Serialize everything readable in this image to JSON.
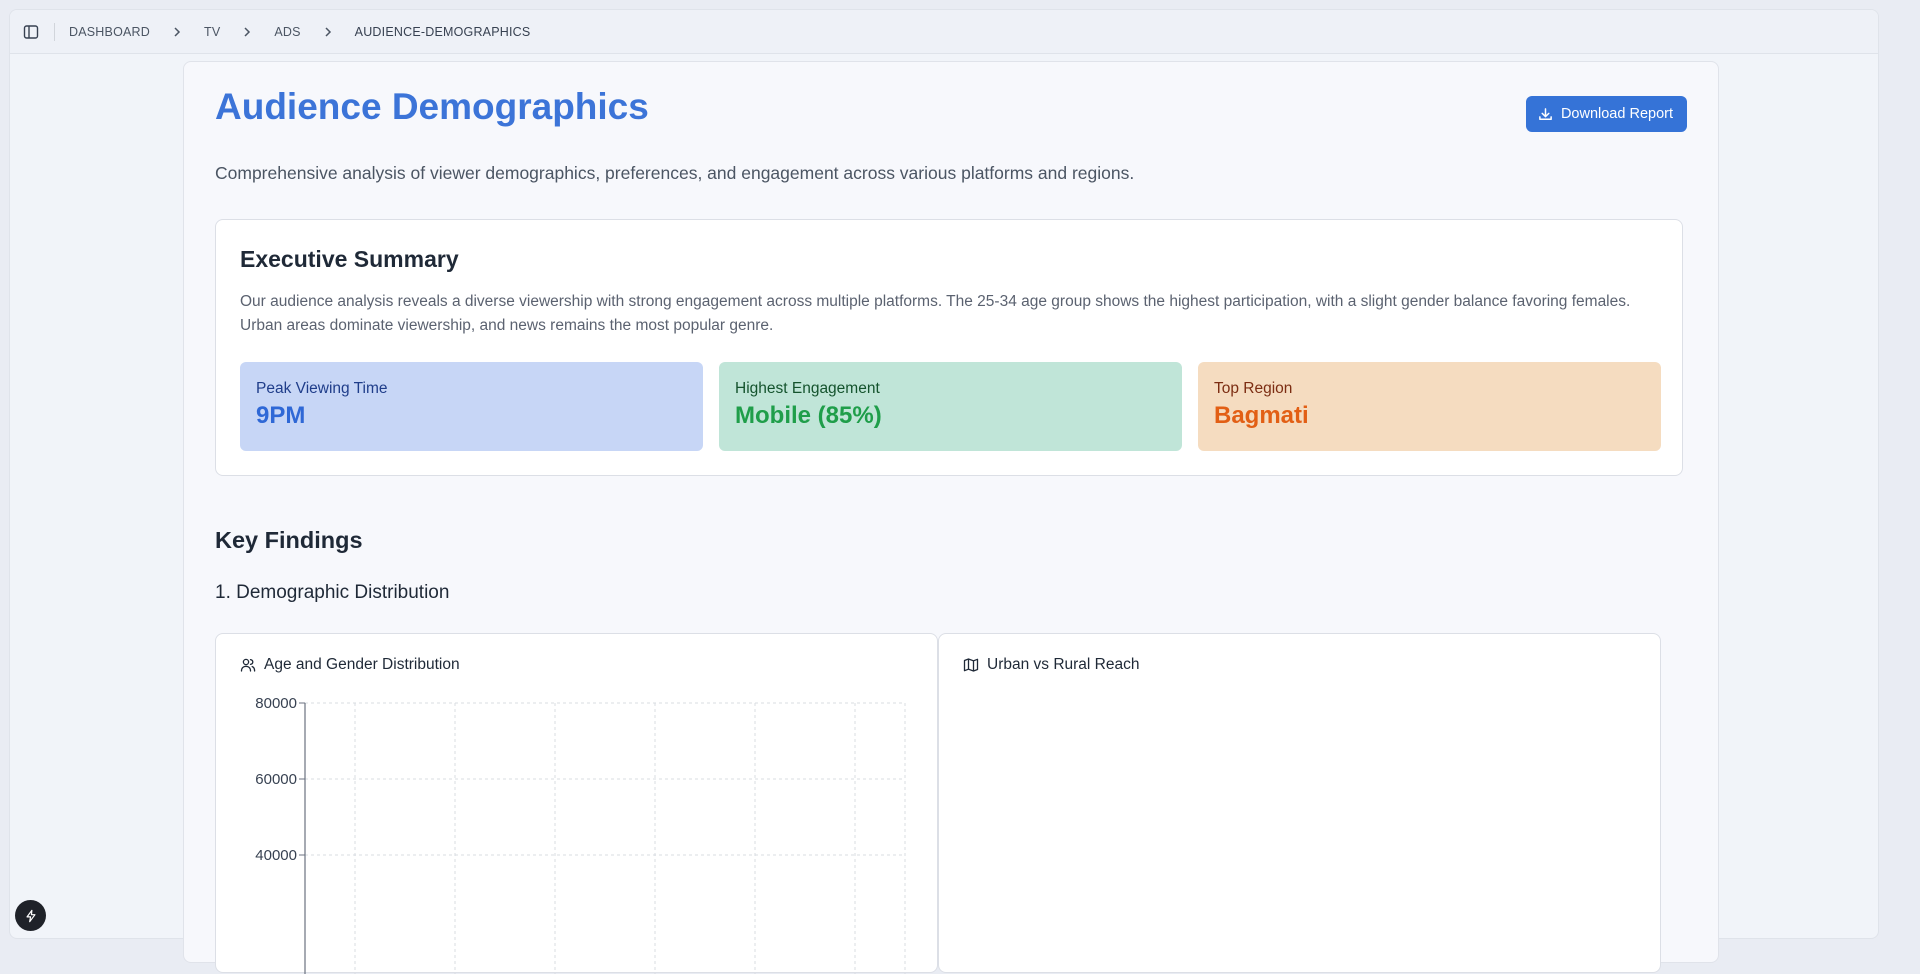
{
  "breadcrumb": [
    "DASHBOARD",
    "TV",
    "ADS",
    "AUDIENCE-DEMOGRAPHICS"
  ],
  "page": {
    "title": "Audience Demographics",
    "subtitle": "Comprehensive analysis of viewer demographics, preferences, and engagement across various platforms and regions.",
    "download_label": "Download Report"
  },
  "summary": {
    "heading": "Executive Summary",
    "text": "Our audience analysis reveals a diverse viewership with strong engagement across multiple platforms. The 25-34 age group shows the highest participation, with a slight gender balance favoring females. Urban areas dominate viewership, and news remains the most popular genre.",
    "stats": [
      {
        "label": "Peak Viewing Time",
        "value": "9PM",
        "color": "#2f68d6"
      },
      {
        "label": "Highest Engagement",
        "value": "Mobile (85%)",
        "color": "#1f9e4a"
      },
      {
        "label": "Top Region",
        "value": "Bagmati",
        "color": "#e25f15"
      }
    ]
  },
  "key_findings": {
    "heading": "Key Findings",
    "section_title": "1. Demographic Distribution",
    "panels": [
      {
        "title": "Age and Gender Distribution",
        "icon": "users-icon"
      },
      {
        "title": "Urban vs Rural Reach",
        "icon": "map-icon"
      }
    ]
  },
  "chart_data": {
    "type": "bar",
    "title": "Age and Gender Distribution",
    "y_ticks": [
      80000,
      60000,
      40000
    ],
    "ylim": [
      20000,
      80000
    ],
    "grid": true,
    "values": []
  }
}
